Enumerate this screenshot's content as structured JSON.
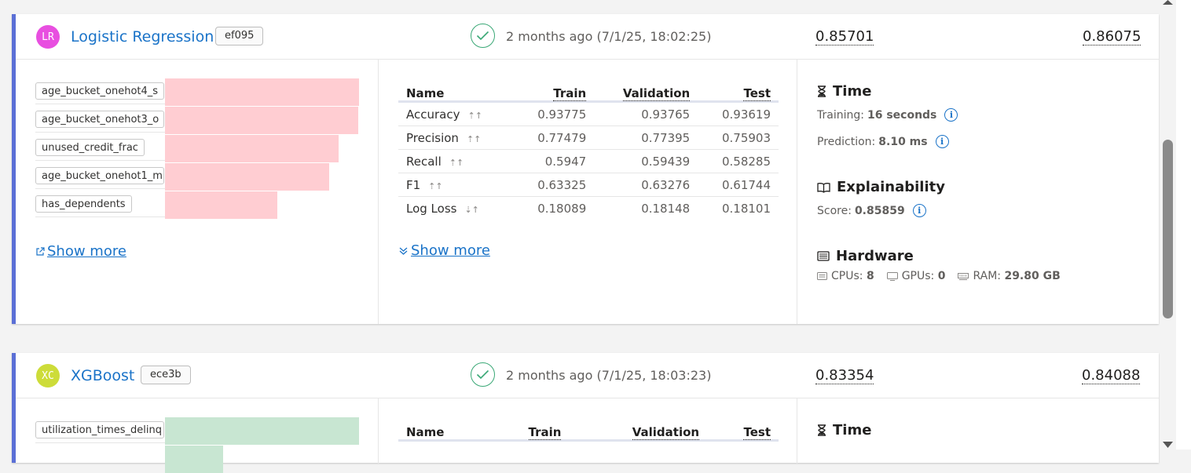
{
  "models": [
    {
      "avatar": "LR",
      "avatar_color": "#e84fe0",
      "name": "Logistic Regression",
      "tag": "ef095",
      "status": "2 months ago (7/1/25, 18:02:25)",
      "score_validation": "0.85701",
      "score_test": "0.86075",
      "features": [
        {
          "name": "age_bucket_onehot4_s",
          "importance": 1.0
        },
        {
          "name": "age_bucket_onehot3_o",
          "importance": 0.99
        },
        {
          "name": "unused_credit_frac",
          "importance": 0.89
        },
        {
          "name": "age_bucket_onehot1_m",
          "importance": 0.84
        },
        {
          "name": "has_dependents",
          "importance": 0.58
        }
      ],
      "feature_color": "#ffcdd2",
      "show_more": "Show more",
      "metrics_headers": {
        "name": "Name",
        "train": "Train",
        "validation": "Validation",
        "test": "Test"
      },
      "metrics": [
        {
          "name": "Accuracy",
          "train": "0.93775",
          "validation": "0.93765",
          "test": "0.93619"
        },
        {
          "name": "Precision",
          "train": "0.77479",
          "validation": "0.77395",
          "test": "0.75903"
        },
        {
          "name": "Recall",
          "train": "0.5947",
          "validation": "0.59439",
          "test": "0.58285"
        },
        {
          "name": "F1",
          "train": "0.63325",
          "validation": "0.63276",
          "test": "0.61744"
        },
        {
          "name": "Log Loss",
          "train": "0.18089",
          "validation": "0.18148",
          "test": "0.18101"
        }
      ],
      "metrics_show_more": "Show more",
      "time": {
        "title": "Time",
        "training_label": "Training:",
        "training_value": "16 seconds",
        "prediction_label": "Prediction:",
        "prediction_value": "8.10 ms"
      },
      "explainability": {
        "title": "Explainability",
        "score_label": "Score:",
        "score_value": "0.85859"
      },
      "hardware": {
        "title": "Hardware",
        "cpus_label": "CPUs:",
        "cpus_value": "8",
        "gpus_label": "GPUs:",
        "gpus_value": "0",
        "ram_label": "RAM:",
        "ram_value": "29.80 GB"
      }
    },
    {
      "avatar": "XC",
      "avatar_color": "#cddc39",
      "name": "XGBoost",
      "tag": "ece3b",
      "status": "2 months ago (7/1/25, 18:03:23)",
      "score_validation": "0.83354",
      "score_test": "0.84088",
      "features": [
        {
          "name": "utilization_times_delinq",
          "importance": 1.0
        },
        {
          "name": "",
          "importance": 0.36
        }
      ],
      "feature_color": "#c8e6d2",
      "metrics_headers": {
        "name": "Name",
        "train": "Train",
        "validation": "Validation",
        "test": "Test"
      },
      "time": {
        "title": "Time"
      }
    }
  ]
}
